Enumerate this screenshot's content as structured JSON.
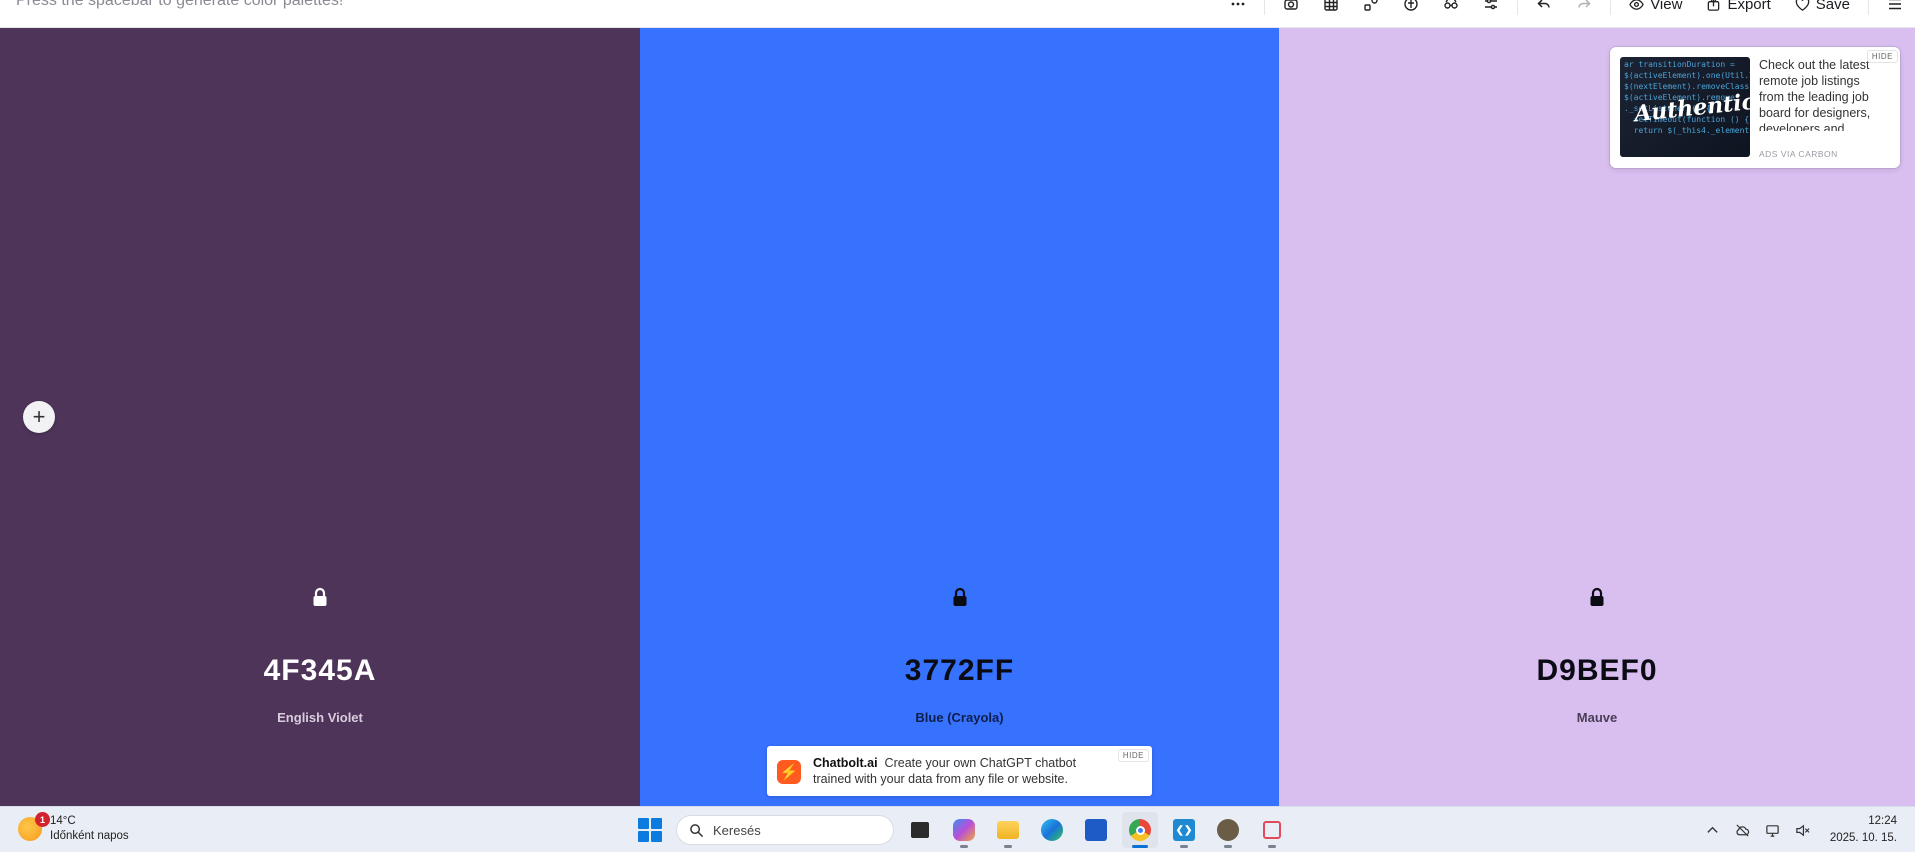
{
  "toolbar": {
    "hint": "Press the spacebar to generate color palettes!",
    "view_label": "View",
    "export_label": "Export",
    "save_label": "Save"
  },
  "palette": [
    {
      "hex": "4F345A",
      "name": "English Violet",
      "bg": "#4F345A",
      "fg": "#FFFFFF",
      "name_color": "#D8CCDD"
    },
    {
      "hex": "3772FF",
      "name": "Blue (Crayola)",
      "bg": "#3772FF",
      "fg": "#0B0B14",
      "name_color": "#0E1E4A"
    },
    {
      "hex": "D9BEF0",
      "name": "Mauve",
      "bg": "#D9BEF0",
      "fg": "#0B0B14",
      "name_color": "#4A3E56"
    }
  ],
  "carbon_ad": {
    "text": "Check out the latest remote job listings from the leading job board for designers, developers and creative pros.",
    "image_logo": "Authentic",
    "image_code": "ar transitionDuration =\n$(activeElement).one(Util.Tr\n$(nextElement).removeClass\n$(activeElement).remove\n._setListeners() {\n  setTimeout(function () {\n  return $(_this4._element",
    "via": "ADS VIA CARBON",
    "hide": "HIDE"
  },
  "chatbolt_ad": {
    "brand": "Chatbolt.ai",
    "text": "Create your own ChatGPT chatbot trained with your data from any file or website.",
    "hide": "HIDE"
  },
  "taskbar": {
    "weather_badge": "1",
    "temperature": "14°C",
    "weather_desc": "Időnként napos",
    "search_placeholder": "Keresés",
    "time": "12:24",
    "date": "2025. 10. 15."
  }
}
